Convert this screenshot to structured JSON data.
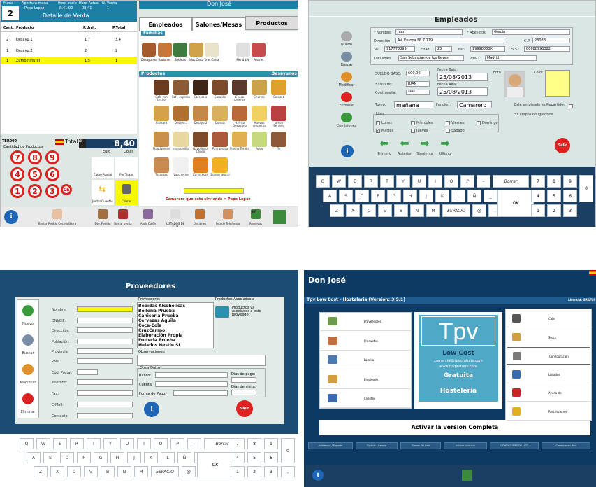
{
  "p1": {
    "hdr_cols": [
      "Mesa",
      "Apertura mesa",
      "Hora Inicio",
      "Hora Actual",
      "N. Venta"
    ],
    "mesa": "2",
    "user": "Pepe Lopez",
    "hora_inicio": "8:41:00",
    "hora_actual": "08:41",
    "n_venta": "1",
    "title": "Detalle de Venta",
    "owner": "Don José",
    "tabs": [
      "Empleados",
      "Salones/Mesas",
      "Productos"
    ],
    "col_heads": [
      "Cant.",
      "Producto",
      "P.Unit.",
      "P.Total"
    ],
    "rows": [
      [
        "2",
        "Desayu.1",
        "1,7",
        "3,4"
      ],
      [
        "1",
        "Desayu.2",
        "2",
        "2"
      ],
      [
        "1",
        "Zumo natural",
        "1,5",
        "1"
      ]
    ],
    "familias": "Familias",
    "fam_items": [
      "Desayunos",
      "Raciones",
      "Bebidas",
      "2dos.Carta",
      "1ros.Carta",
      "Menú L-V",
      "Postres"
    ],
    "fam_num": "6",
    "productos": "Productos",
    "desayunos": "Desayunos",
    "prod_items": [
      "Cafe con Leche",
      "Cafe expreso",
      "Cafe solo",
      "Carajillo",
      "Choco caliente",
      "Churros",
      "Colacao",
      "Croisant",
      "Desayu.1",
      "Desayu.2",
      "Donuts",
      "H. Frito Desayuno",
      "Huevos revueltos",
      "Jamon Serrano",
      "Magdalenas",
      "manzanilla",
      "Napolitana Choco",
      "Pantumaca",
      "Pincho Tortilla",
      "Poleo",
      "Te",
      "Tostadas",
      "Vaso leche",
      "Zumo bote",
      "Zumo natural"
    ],
    "tercero": "TER000",
    "total_label": "Total",
    "total_value": "8,40",
    "euro": "Euro",
    "dolar": "Dolar",
    "cantidad": "Cantidad de Productos",
    "nums": [
      "7",
      "8",
      "9",
      "4",
      "5",
      "6",
      "1",
      "2",
      "3",
      "CE"
    ],
    "cobro_parcial": "Cobro Parcial",
    "pre_ticket": "Pre Ticket",
    "juntar": "Juntar Cuentas",
    "cobrar": "Cobrar",
    "camarero": "Camarero que esta sirviendo = Pepe Lopez",
    "toolbar": [
      "Enviar Pedido Cocina/Barra",
      "Dto. Pedido",
      "Borrar venta",
      "Abrir Cajón",
      "LISTADOS DE CAJA",
      "Opciones",
      "Pedido Telefonico",
      "Reservas"
    ],
    "reservas_day": "30"
  },
  "p2": {
    "title": "Empleados",
    "side": [
      "Nuevo",
      "Buscar",
      "Modificar",
      "Eliminar",
      "Comisiones"
    ],
    "f": {
      "nombre_l": "* Nombre:",
      "nombre": "Juan",
      "apellidos_l": "* Apellidos:",
      "apellidos": "Garcia",
      "direccion_l": "Dirección:",
      "direccion": "AV. Europa Nº 7 119",
      "cp_l": "C.P.",
      "cp": "28088",
      "tel_l": "Tel:",
      "tel": "917778899",
      "edad_l": "Edad:",
      "edad": "25",
      "nif_l": "NIF:",
      "nif": "99998833X",
      "ss_l": "S.S.:",
      "ss": "86688993322",
      "localidad_l": "Localidad:",
      "localidad": "San Sebastian de los Reyes",
      "prov_l": "Prov.:",
      "prov": "Madrid",
      "sueldo_l": "SUELDO BASE:",
      "sueldo": "600,00",
      "fbaja_l": "Fecha Baja:",
      "fbaja": "25/08/2013",
      "falta_l": "Fecha Alta:",
      "falta": "25/08/2013",
      "usuario_l": "* Usuario:",
      "usuario": "JUAN",
      "contra_l": "Contraseña:",
      "contra": "****",
      "turno_l": "Turno:",
      "turno": "mañana",
      "funcion_l": "Función:",
      "funcion": "Camarero",
      "foto_l": "Foto",
      "color_l": "Color",
      "repartidor": "Este empleado es Repartidor",
      "oblig": "* Campos obligatorios",
      "libra": "Libra"
    },
    "days": [
      "Lunes",
      "Miercoles",
      "Viernes",
      "Domingo",
      "Martes",
      "Jueves",
      "Sábado"
    ],
    "nav": [
      "Primero",
      "Anterior",
      "Siguiente",
      "Ultimo"
    ],
    "salir": "Salir",
    "kb1": [
      "Q",
      "W",
      "E",
      "R",
      "T",
      "Y",
      "U",
      "I",
      "O",
      "P",
      "-",
      "Borrar"
    ],
    "kb2": [
      "A",
      "S",
      "D",
      "F",
      "G",
      "H",
      "J",
      "K",
      "L",
      "Ñ",
      "_"
    ],
    "kb3": [
      "Z",
      "X",
      "C",
      "V",
      "B",
      "N",
      "M",
      "ESPACIO",
      "@",
      "."
    ],
    "ok": "OK",
    "np": [
      "7",
      "8",
      "9",
      "4",
      "5",
      "6",
      "1",
      "2",
      "3"
    ],
    "zero": "0"
  },
  "p3": {
    "title": "Proveedores",
    "side": [
      "Nuevo",
      "Buscar",
      "Modificar",
      "Eliminar"
    ],
    "labels": [
      "Nombre:",
      "DNI/CIF:",
      "Dirección:",
      "Población:",
      "Provincia:",
      "País:",
      "Cód. Postal:",
      "Teléfono:",
      "Fax:",
      "E-Mail:",
      "Contacto:"
    ],
    "prov_l": "Proveedores",
    "asoc_l": "Productos Asociados a",
    "list": [
      "Bebidas Alcoholicas",
      "Bolleria Prueba",
      "Caniceria Prueba",
      "Cervezas Aguila",
      "Coca-Cola",
      "CruzCampo",
      "Elaboración Propia",
      "Fruteria Prueba",
      "Helados Nestle SL"
    ],
    "asoc_txt": "Productos ya asociados a este proveedor",
    "obs": "Observaciones:",
    "otros": "Otros Datos",
    "banco": "Banco:",
    "cuenta": "Cuenta:",
    "forma": "Forma de Pago:",
    "dias_pago": "Días de pago:",
    "dias_visita": "Días de visita:",
    "salir": "Salir",
    "kb1": [
      "Q",
      "W",
      "E",
      "R",
      "T",
      "Y",
      "U",
      "I",
      "O",
      "P",
      "-",
      "Borrar"
    ],
    "kb2": [
      "A",
      "S",
      "D",
      "F",
      "G",
      "H",
      "J",
      "K",
      "L",
      "Ñ",
      "_"
    ],
    "kb3": [
      "Z",
      "X",
      "C",
      "V",
      "B",
      "N",
      "M",
      "ESPACIO",
      "@",
      "."
    ],
    "ok": "OK",
    "np": [
      "7",
      "8",
      "9",
      "4",
      "5",
      "6",
      "1",
      "2",
      "3"
    ],
    "zero": "0",
    "comma": ","
  },
  "p4": {
    "title": "Don José",
    "subtitle": "Tpv Low Cost - Hosteleria (Version: 3.9.1)",
    "licencia": "Licencia: GRATUI",
    "left_menu": [
      "Proveedores",
      "Productos",
      "Familia",
      "Empleado",
      "Clientes"
    ],
    "right_menu": [
      "Caja",
      "Stock",
      "Configuración",
      "Listados",
      "Ayuda de",
      "Restricciones"
    ],
    "logo": "Tpv",
    "lowcost": "Low Cost",
    "email": "comercial@tpvgratuito.com",
    "web": "www.tpvgratuito.com",
    "gratuita": "Gratuita",
    "hosteleria": "Hosteleria",
    "activar": "Activar la version Completa",
    "footer": [
      "Asistencia / Soporte",
      "Tipo de Licencia",
      "Tienda On Line",
      "Activar Licencia",
      "CONDICIONES DE USO",
      "Conectar en Red"
    ]
  },
  "colors": {
    "red": "#d22222",
    "blue": "#1b4d72",
    "teal": "#2e8fae",
    "yellow": "#f7f700"
  }
}
